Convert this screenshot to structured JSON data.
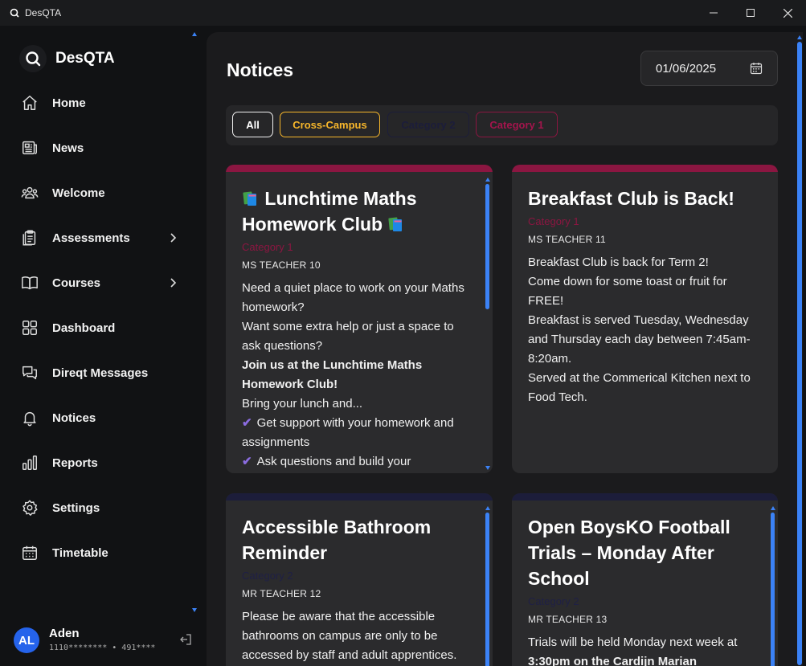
{
  "window": {
    "title": "DesQTA"
  },
  "brand": {
    "name": "DesQTA"
  },
  "nav": [
    {
      "label": "Home"
    },
    {
      "label": "News"
    },
    {
      "label": "Welcome"
    },
    {
      "label": "Assessments"
    },
    {
      "label": "Courses"
    },
    {
      "label": "Dashboard"
    },
    {
      "label": "Direqt Messages"
    },
    {
      "label": "Notices"
    },
    {
      "label": "Reports"
    },
    {
      "label": "Settings"
    },
    {
      "label": "Timetable"
    }
  ],
  "user": {
    "initials": "AL",
    "name": "Aden",
    "id_line": "1110******** • 491****"
  },
  "page": {
    "title": "Notices",
    "date": "01/06/2025"
  },
  "filters": {
    "all": "All",
    "cross_campus": "Cross-Campus",
    "category2": "Category 2",
    "category1": "Category 1"
  },
  "colors": {
    "cross_campus": "#f6b62b",
    "category1": "#a3154c",
    "category2": "#1c1d3a",
    "accent": "#3b82f6"
  },
  "notices": [
    {
      "title": "Lunchtime Maths Homework Club",
      "category": "Category 1",
      "author": "MS TEACHER 10",
      "lines": {
        "l1": "Need a quiet place to work on your Maths homework?",
        "l2": "Want some extra help or just a space to ask questions?",
        "l3": "Join us at the Lunchtime Maths Homework Club!",
        "l4": "Bring your lunch and...",
        "l5": "Get support with your homework and assignments",
        "l6": "Ask questions and build your"
      }
    },
    {
      "title": "Breakfast Club is Back!",
      "category": "Category 1",
      "author": "MS TEACHER 11",
      "lines": {
        "l1": "Breakfast Club is back for Term 2!",
        "l2": "Come down for some toast or fruit for FREE!",
        "l3": "Breakfast is served Tuesday, Wednesday and Thursday each day between 7:45am-8:20am.",
        "l4": "Served at the Commerical Kitchen next to Food Tech."
      }
    },
    {
      "title": "Accessible Bathroom Reminder",
      "category": "Category 2",
      "author": "MR TEACHER 12",
      "lines": {
        "l1": "Please be aware that the accessible bathrooms on campus are only to be accessed by staff and adult apprentices."
      }
    },
    {
      "title": "Open BoysKO Football Trials – Monday After School",
      "category": "Category 2",
      "author": "MR TEACHER 13",
      "lines": {
        "l1": "Trials will be held Monday next week at",
        "l2": "3:30pm on the Cardijn Marian"
      }
    }
  ]
}
